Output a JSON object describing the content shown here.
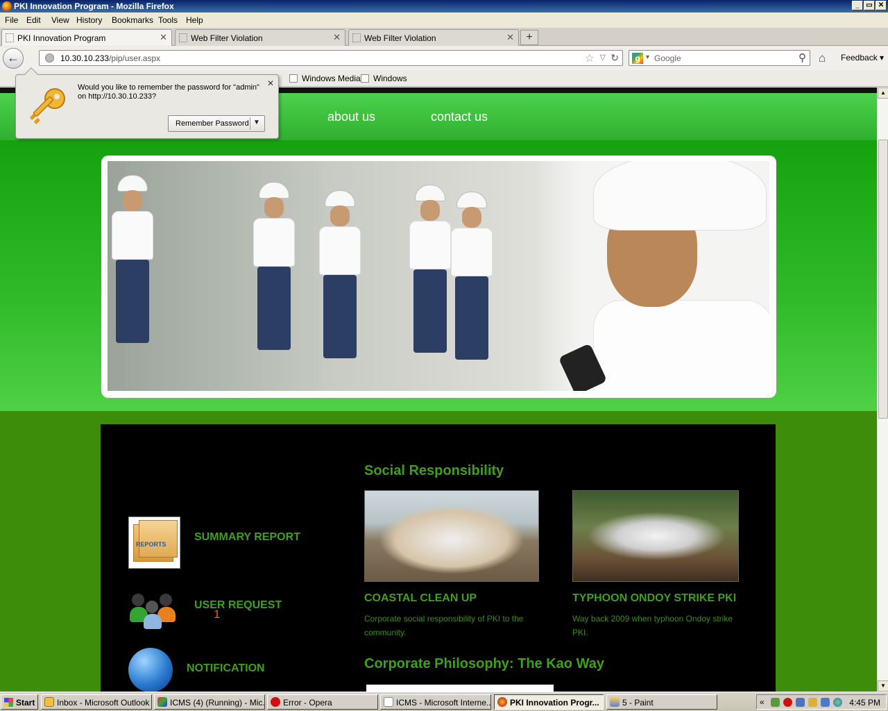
{
  "window": {
    "title": "PKI Innovation Program - Mozilla Firefox",
    "controls": [
      "_",
      "▭",
      "✕"
    ]
  },
  "menu": [
    "File",
    "Edit",
    "View",
    "History",
    "Bookmarks",
    "Tools",
    "Help"
  ],
  "tabs": [
    {
      "label": "PKI Innovation Program",
      "active": true
    },
    {
      "label": "Web Filter Violation",
      "active": false
    },
    {
      "label": "Web Filter Violation",
      "active": false
    }
  ],
  "new_tab_label": "+",
  "navbar": {
    "url_host": "10.30.10.233",
    "url_path": "/pip/user.aspx",
    "search_placeholder": "Google",
    "feedback_label": "Feedback"
  },
  "bookmarks": [
    "Windows Media",
    "Windows"
  ],
  "password_prompt": {
    "message": "Would you like to remember the password for \"admin\" on http://10.30.10.233?",
    "button_label": "Remember Password"
  },
  "site": {
    "nav": [
      "about us",
      "contact us"
    ],
    "sidebar": {
      "summary_report": "SUMMARY REPORT",
      "reports_icon_text": "REPORTS",
      "user_request": "USER REQUEST",
      "user_request_count": "1",
      "notification": "NOTIFICATION"
    },
    "social_title": "Social Responsibility",
    "cards": [
      {
        "title": "COASTAL CLEAN UP",
        "text": "Corporate social responsibility of PKI to the community."
      },
      {
        "title": "TYPHOON ONDOY STRIKE PKI",
        "text": "Way back 2009 when typhoon Ondoy strike PKI."
      }
    ],
    "philosophy_title": "Corporate Philosophy: The Kao Way"
  },
  "taskbar": {
    "start_label": "Start",
    "items": [
      {
        "label": "Inbox - Microsoft Outlook",
        "active": false
      },
      {
        "label": "ICMS (4) (Running) - Mic...",
        "active": false
      },
      {
        "label": "Error - Opera",
        "active": false
      },
      {
        "label": "ICMS - Microsoft Interne...",
        "active": false
      },
      {
        "label": "PKI Innovation Progr...",
        "active": true
      },
      {
        "label": "5 - Paint",
        "active": false
      }
    ],
    "tray_expand": "«",
    "clock": "4:45 PM"
  },
  "colors": {
    "site_green": "#3fa01c",
    "count_orange": "#e06a10",
    "nav_band": "#2fb02f",
    "panel_black": "#000000"
  }
}
